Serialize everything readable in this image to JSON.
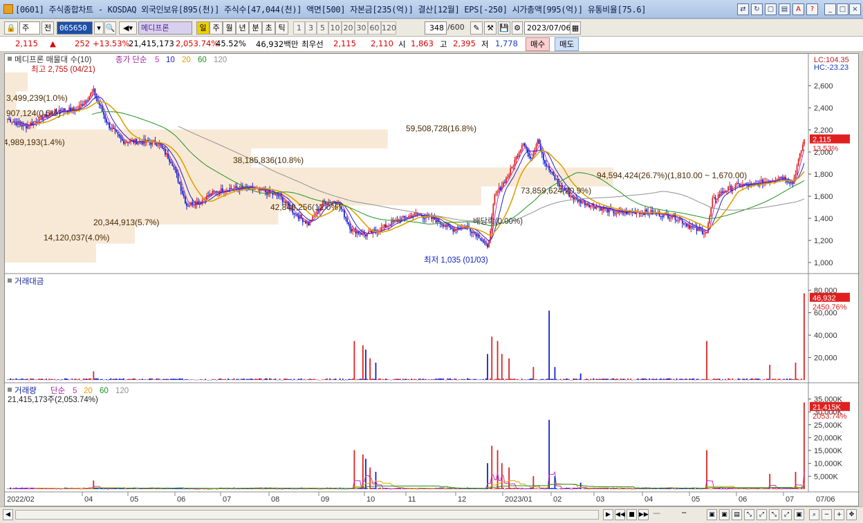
{
  "window": {
    "title": "[0601] 주식종합차트 - KOSDAQ 외국인보유[895(천)] 주식수[47,044(천)] 액면[500] 자본금[235(억)] 결산[12월] EPS[-250] 시가총액[995(억)] 유통비율[75.6]"
  },
  "toolbar": {
    "market": "주",
    "prev_label": "전",
    "code": "065650",
    "name": "메디프론",
    "period_tabs": [
      "일",
      "주",
      "월",
      "년",
      "분",
      "초",
      "틱"
    ],
    "active_period": "일",
    "periods": [
      "1",
      "3",
      "5",
      "10",
      "20",
      "30",
      "60",
      "120"
    ],
    "count": "348",
    "count_total": "/600",
    "date": "2023/07/06"
  },
  "pricebar": {
    "price": "2,115",
    "arrow": "▲",
    "change": "252",
    "rate": "+13.53%",
    "volume": "21,415,173",
    "vol_rate": "2,053.74%",
    "turnover": "45.52%",
    "amount": "46,932백만",
    "best_label": "최우선",
    "ask": "2,115",
    "bid": "2,110",
    "open_label": "시",
    "open": "1,863",
    "high_label": "고",
    "high": "2,395",
    "low_label": "저",
    "low": "1,778",
    "buy_label": "매수",
    "sell_label": "매도"
  },
  "price_pane": {
    "legend": {
      "name": "메디프론 매물대 수(10)",
      "ma_label": "종가 단순",
      "ma_periods": [
        "5",
        "10",
        "20",
        "60",
        "120"
      ],
      "ma_colors": [
        "#c030c0",
        "#2020c0",
        "#e0a000",
        "#209020",
        "#909090"
      ]
    },
    "lc": "LC:104.35",
    "hc": "HC:-23.23",
    "y_ticks": [
      "2,600",
      "2,400",
      "2,200",
      "2,000",
      "1,800",
      "1,600",
      "1,400",
      "1,200",
      "1,000"
    ],
    "current_price_tag": "2,115",
    "current_rate_tag": "13.53%",
    "high_annotation": "최고 2,755 (04/21)",
    "low_annotation": "최저 1,035 (01/03)",
    "dividend_annotation": "배당락(0.00%)"
  },
  "chart_data": [
    {
      "type": "volume_profile",
      "title": "메디프론 매물대 수(10)",
      "bins": [
        {
          "range": [
            1000,
            1172
          ],
          "label": "14,120,037(4.0%)",
          "pct": 4.0
        },
        {
          "range": [
            1172,
            1344
          ],
          "label": "20,344,913(5.7%)",
          "pct": 5.7
        },
        {
          "range": [
            1344,
            1516
          ],
          "label": "42,848,256(12.0%)",
          "pct": 12.0
        },
        {
          "range": [
            1516,
            1688
          ],
          "label": "73,859,624(20.9%)",
          "pct": 20.9
        },
        {
          "range": [
            1688,
            1860
          ],
          "label": "94,594,424(26.7%)(1,810.00 ~ 1,670.00)",
          "pct": 26.7
        },
        {
          "range": [
            1860,
            2032
          ],
          "label": "38,185,836(10.8%)",
          "pct": 10.8
        },
        {
          "range": [
            2032,
            2204
          ],
          "label": "59,508,728(16.8%)",
          "pct": 16.8
        },
        {
          "range": [
            2204,
            2376
          ],
          "label": "4,989,193(1.4%)",
          "pct": 1.4
        },
        {
          "range": [
            2376,
            2548
          ],
          "label": "907,124(0.5%)",
          "pct": 0.5
        },
        {
          "range": [
            2548,
            2720
          ],
          "label": "3,499,239(1.0%)",
          "pct": 1.0
        }
      ]
    },
    {
      "type": "candlestick",
      "ylim": [
        950,
        2800
      ],
      "x_ticks": [
        "2022/02",
        "04",
        "05",
        "06",
        "07",
        "08",
        "09",
        "10",
        "11",
        "12",
        "2023/01",
        "02",
        "03",
        "04",
        "05",
        "06",
        "07",
        "07/06"
      ],
      "anchors": [
        [
          0,
          2300
        ],
        [
          12,
          2230
        ],
        [
          24,
          2310
        ],
        [
          36,
          2380
        ],
        [
          48,
          2380
        ],
        [
          60,
          2550
        ],
        [
          70,
          2250
        ],
        [
          80,
          2100
        ],
        [
          95,
          2090
        ],
        [
          105,
          2080
        ],
        [
          115,
          1900
        ],
        [
          125,
          1520
        ],
        [
          135,
          1560
        ],
        [
          145,
          1640
        ],
        [
          155,
          1670
        ],
        [
          170,
          1670
        ],
        [
          180,
          1640
        ],
        [
          190,
          1600
        ],
        [
          200,
          1450
        ],
        [
          210,
          1350
        ],
        [
          220,
          1540
        ],
        [
          230,
          1560
        ],
        [
          240,
          1300
        ],
        [
          250,
          1250
        ],
        [
          260,
          1300
        ],
        [
          270,
          1370
        ],
        [
          285,
          1440
        ],
        [
          300,
          1380
        ],
        [
          310,
          1300
        ],
        [
          320,
          1330
        ],
        [
          330,
          1230
        ],
        [
          335,
          1120
        ],
        [
          340,
          1600
        ],
        [
          350,
          1800
        ],
        [
          360,
          2100
        ],
        [
          365,
          1920
        ],
        [
          370,
          2130
        ],
        [
          375,
          1900
        ],
        [
          385,
          1700
        ],
        [
          395,
          1580
        ],
        [
          405,
          1530
        ],
        [
          415,
          1490
        ],
        [
          425,
          1450
        ],
        [
          440,
          1460
        ],
        [
          450,
          1450
        ],
        [
          465,
          1420
        ],
        [
          480,
          1300
        ],
        [
          488,
          1270
        ],
        [
          492,
          1560
        ],
        [
          500,
          1650
        ],
        [
          510,
          1700
        ],
        [
          520,
          1700
        ],
        [
          530,
          1740
        ],
        [
          540,
          1780
        ],
        [
          548,
          1720
        ],
        [
          556,
          2115
        ]
      ]
    },
    {
      "type": "bar",
      "title": "거래대금",
      "y_ticks": [
        "80,000",
        "60,000",
        "40,000",
        "20,000"
      ],
      "current_tag": "46,932",
      "current_rate": "2450.76%"
    },
    {
      "type": "bar",
      "title": "거래량",
      "ma_label": "단순",
      "ma_periods": [
        "5",
        "20",
        "60",
        "120"
      ],
      "summary": "21,415,173주(2,053.74%)",
      "y_ticks": [
        "35,000K",
        "30,000K",
        "25,000K",
        "20,000K",
        "15,000K",
        "10,000K",
        "5,000K"
      ],
      "current_tag": "21,415K",
      "current_rate": "2053.74%"
    }
  ]
}
